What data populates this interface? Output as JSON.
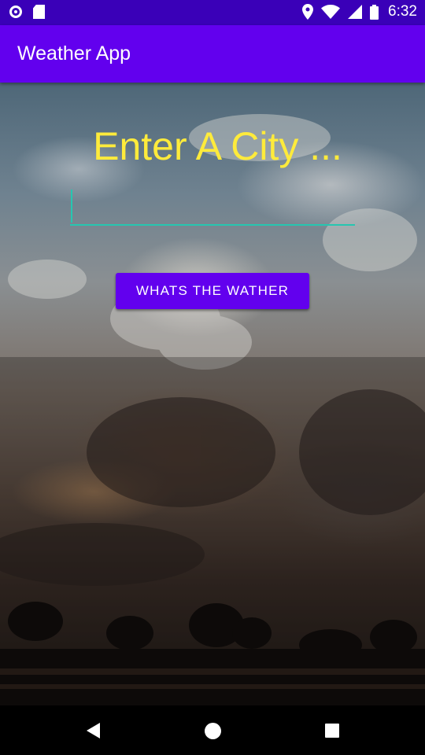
{
  "status_bar": {
    "time": "6:32",
    "left_icons": [
      "circle-notification-icon",
      "sd-card-icon"
    ],
    "right_icons": [
      "location-icon",
      "wifi-icon",
      "signal-icon",
      "battery-icon"
    ]
  },
  "app_bar": {
    "title": "Weather App",
    "color": "#6200ee"
  },
  "main": {
    "prompt": "Enter A City ...",
    "prompt_color": "#ffeb3b",
    "city_input": {
      "value": "",
      "placeholder": ""
    },
    "button_label": "WHATS THE WATHER",
    "accent_color": "#26c6b0"
  },
  "nav_bar": {
    "buttons": [
      "back-icon",
      "home-icon",
      "recents-icon"
    ]
  }
}
